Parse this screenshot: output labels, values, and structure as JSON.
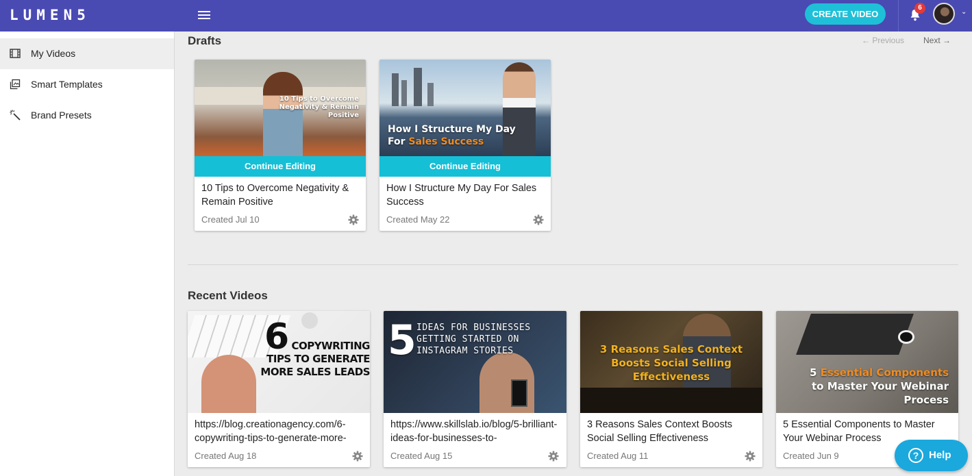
{
  "app": {
    "logo": "LUMEN5"
  },
  "header": {
    "create_label": "CREATE VIDEO",
    "notification_count": "6",
    "caret": "⌄"
  },
  "sidebar": {
    "items": [
      {
        "label": "My Videos",
        "icon": "film-icon",
        "active": true
      },
      {
        "label": "Smart Templates",
        "icon": "templates-icon",
        "active": false
      },
      {
        "label": "Brand Presets",
        "icon": "magic-wand-icon",
        "active": false
      }
    ]
  },
  "drafts": {
    "title": "Drafts",
    "previous_label": "← Previous",
    "next_label": "Next →",
    "continue_label": "Continue Editing",
    "cards": [
      {
        "thumb_text": "10 Tips to Overcome Negativity & Remain Positive",
        "title": "10 Tips to Overcome Negativity & Remain Positive",
        "date": "Created Jul 10"
      },
      {
        "thumb_text_1": "How I Structure My Day",
        "thumb_text_2a": "For ",
        "thumb_text_2b": "Sales Success",
        "title": "How I Structure My Day For Sales Success",
        "date": "Created May 22"
      }
    ]
  },
  "recent": {
    "title": "Recent Videos",
    "cards": [
      {
        "thumb_big": "6",
        "thumb_line1": "COPYWRITING",
        "thumb_line2": "TIPS TO GENERATE",
        "thumb_line3": "MORE SALES LEADS",
        "title": "https://blog.creationagency.com/6-copywriting-tips-to-generate-more-",
        "date": "Created Aug 18"
      },
      {
        "thumb_big": "5",
        "thumb_line1": "IDEAS FOR BUSINESSES",
        "thumb_line2": "GETTING STARTED ON",
        "thumb_line3": "INSTAGRAM STORIES",
        "title": "https://www.skillslab.io/blog/5-brilliant-ideas-for-businesses-to-",
        "date": "Created Aug 15"
      },
      {
        "thumb_line1": "3 Reasons Sales Context",
        "thumb_line2": "Boosts Social Selling",
        "thumb_line3": "Effectiveness",
        "title": "3 Reasons Sales Context Boosts Social Selling Effectiveness",
        "date": "Created Aug 11"
      },
      {
        "thumb_line1a": "5 ",
        "thumb_line1b": "Essential Components",
        "thumb_line2": "to Master Your Webinar",
        "thumb_line3": "Process",
        "title": "5 Essential Components to Master Your Webinar Process",
        "date": "Created Jun 9"
      }
    ]
  },
  "help": {
    "label": "Help",
    "symbol": "?"
  },
  "colors": {
    "brand": "#4a4ab3",
    "accent": "#1ec0d8",
    "orange": "#f28b1e",
    "badge": "#e23a3a"
  }
}
